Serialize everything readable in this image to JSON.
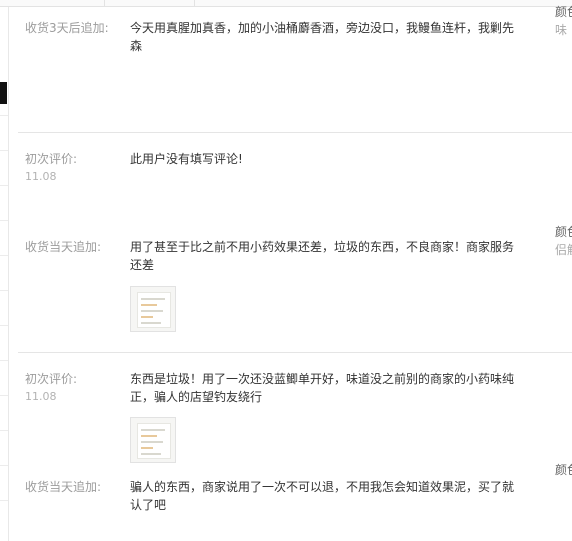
{
  "reviews": [
    {
      "initial": null,
      "append": {
        "label": "收货3天后追加:",
        "text": "今天用真腥加真香，加的小油桶麝香酒，旁边没口，我鳗鱼连杆，我剿先森"
      },
      "side": {
        "line1": "颜色",
        "line2": "味"
      }
    },
    {
      "initial": {
        "label": "初次评价:",
        "date": "11.08",
        "text": "此用户没有填写评论!"
      },
      "append": {
        "label": "收货当天追加:",
        "text": "用了甚至于比之前不用小药效果还差，垃圾的东西，不良商家！商家服务还差"
      },
      "side": {
        "line1": "颜色",
        "line2": "侣触"
      }
    },
    {
      "initial": {
        "label": "初次评价:",
        "date": "11.08",
        "text": "东西是垃圾！用了一次还没蓝鲫单开好，味道没之前别的商家的小药味纯正，骗人的店望钓友绕行"
      },
      "append": {
        "label": "收货当天追加:",
        "text": "骗人的东西，商家说用了一次不可以退，不用我怎会知道效果泥，买了就认了吧"
      },
      "side": {
        "line1": "颜色",
        "line2": ""
      }
    }
  ]
}
